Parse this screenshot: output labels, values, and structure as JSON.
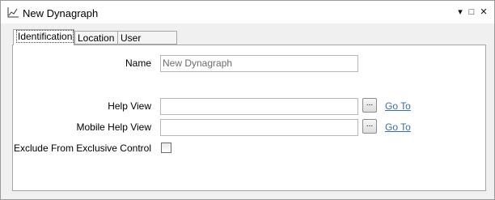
{
  "window": {
    "title": "New Dynagraph",
    "controls": {
      "dropdown": "▾",
      "maximize": "□",
      "close": "✕"
    }
  },
  "tabs": [
    {
      "label": "Identification",
      "active": true
    },
    {
      "label": "Location",
      "active": false
    },
    {
      "label": "User Methods",
      "active": false
    }
  ],
  "form": {
    "name_label": "Name",
    "name_value": "New Dynagraph",
    "help_view_label": "Help View",
    "help_view_value": "",
    "help_view_button": "...",
    "help_view_link": "Go To",
    "mobile_help_view_label": "Mobile Help View",
    "mobile_help_view_value": "",
    "mobile_help_view_button": "...",
    "mobile_help_view_link": "Go To",
    "exclude_label": "Exclude From Exclusive Control",
    "exclude_checked": false
  },
  "icons": {
    "title_icon": "chart-line-icon"
  },
  "colors": {
    "link": "#3a6ea5",
    "border": "#a6a6a6",
    "background": "#f0f0f0"
  }
}
